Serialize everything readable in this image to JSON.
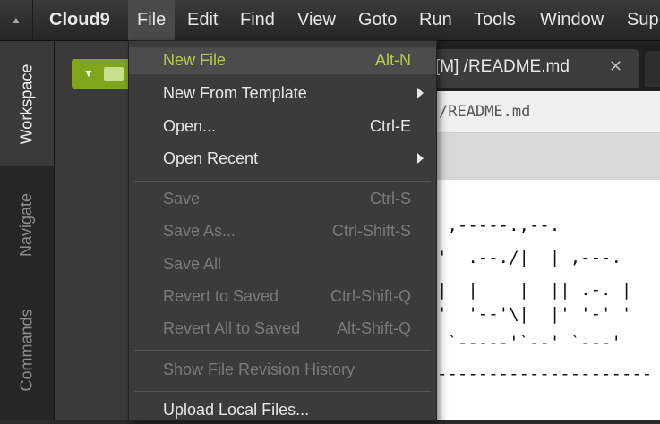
{
  "app": {
    "brand": "Cloud9"
  },
  "menubar": {
    "items": [
      "File",
      "Edit",
      "Find",
      "View",
      "Goto",
      "Run",
      "Tools",
      "Window",
      "Sup"
    ]
  },
  "sidebar": {
    "tabs": [
      "Workspace",
      "Navigate",
      "Commands"
    ]
  },
  "editor": {
    "tab_title": "[M] /README.md",
    "path": "/README.md",
    "ascii_lines": [
      " ,-----.,--.",
      "'  .--./|  | ,---.",
      "|  |    |  || .-. |",
      "'  '--'\\|  |' '-' '",
      " `-----'`--' `---'",
      "---------------------"
    ]
  },
  "file_menu": {
    "items": [
      {
        "label": "New File",
        "shortcut": "Alt-N",
        "state": "highlighted"
      },
      {
        "label": "New From Template",
        "submenu": true,
        "state": "enabled"
      },
      {
        "label": "Open...",
        "shortcut": "Ctrl-E",
        "state": "enabled"
      },
      {
        "label": "Open Recent",
        "submenu": true,
        "state": "enabled"
      },
      {
        "label": "Save",
        "shortcut": "Ctrl-S",
        "state": "disabled"
      },
      {
        "label": "Save As...",
        "shortcut": "Ctrl-Shift-S",
        "state": "disabled"
      },
      {
        "label": "Save All",
        "state": "disabled"
      },
      {
        "label": "Revert to Saved",
        "shortcut": "Ctrl-Shift-Q",
        "state": "disabled"
      },
      {
        "label": "Revert All to Saved",
        "shortcut": "Alt-Shift-Q",
        "state": "disabled"
      },
      {
        "label": "Show File Revision History",
        "state": "disabled"
      },
      {
        "label": "Upload Local Files...",
        "state": "enabled"
      }
    ]
  }
}
